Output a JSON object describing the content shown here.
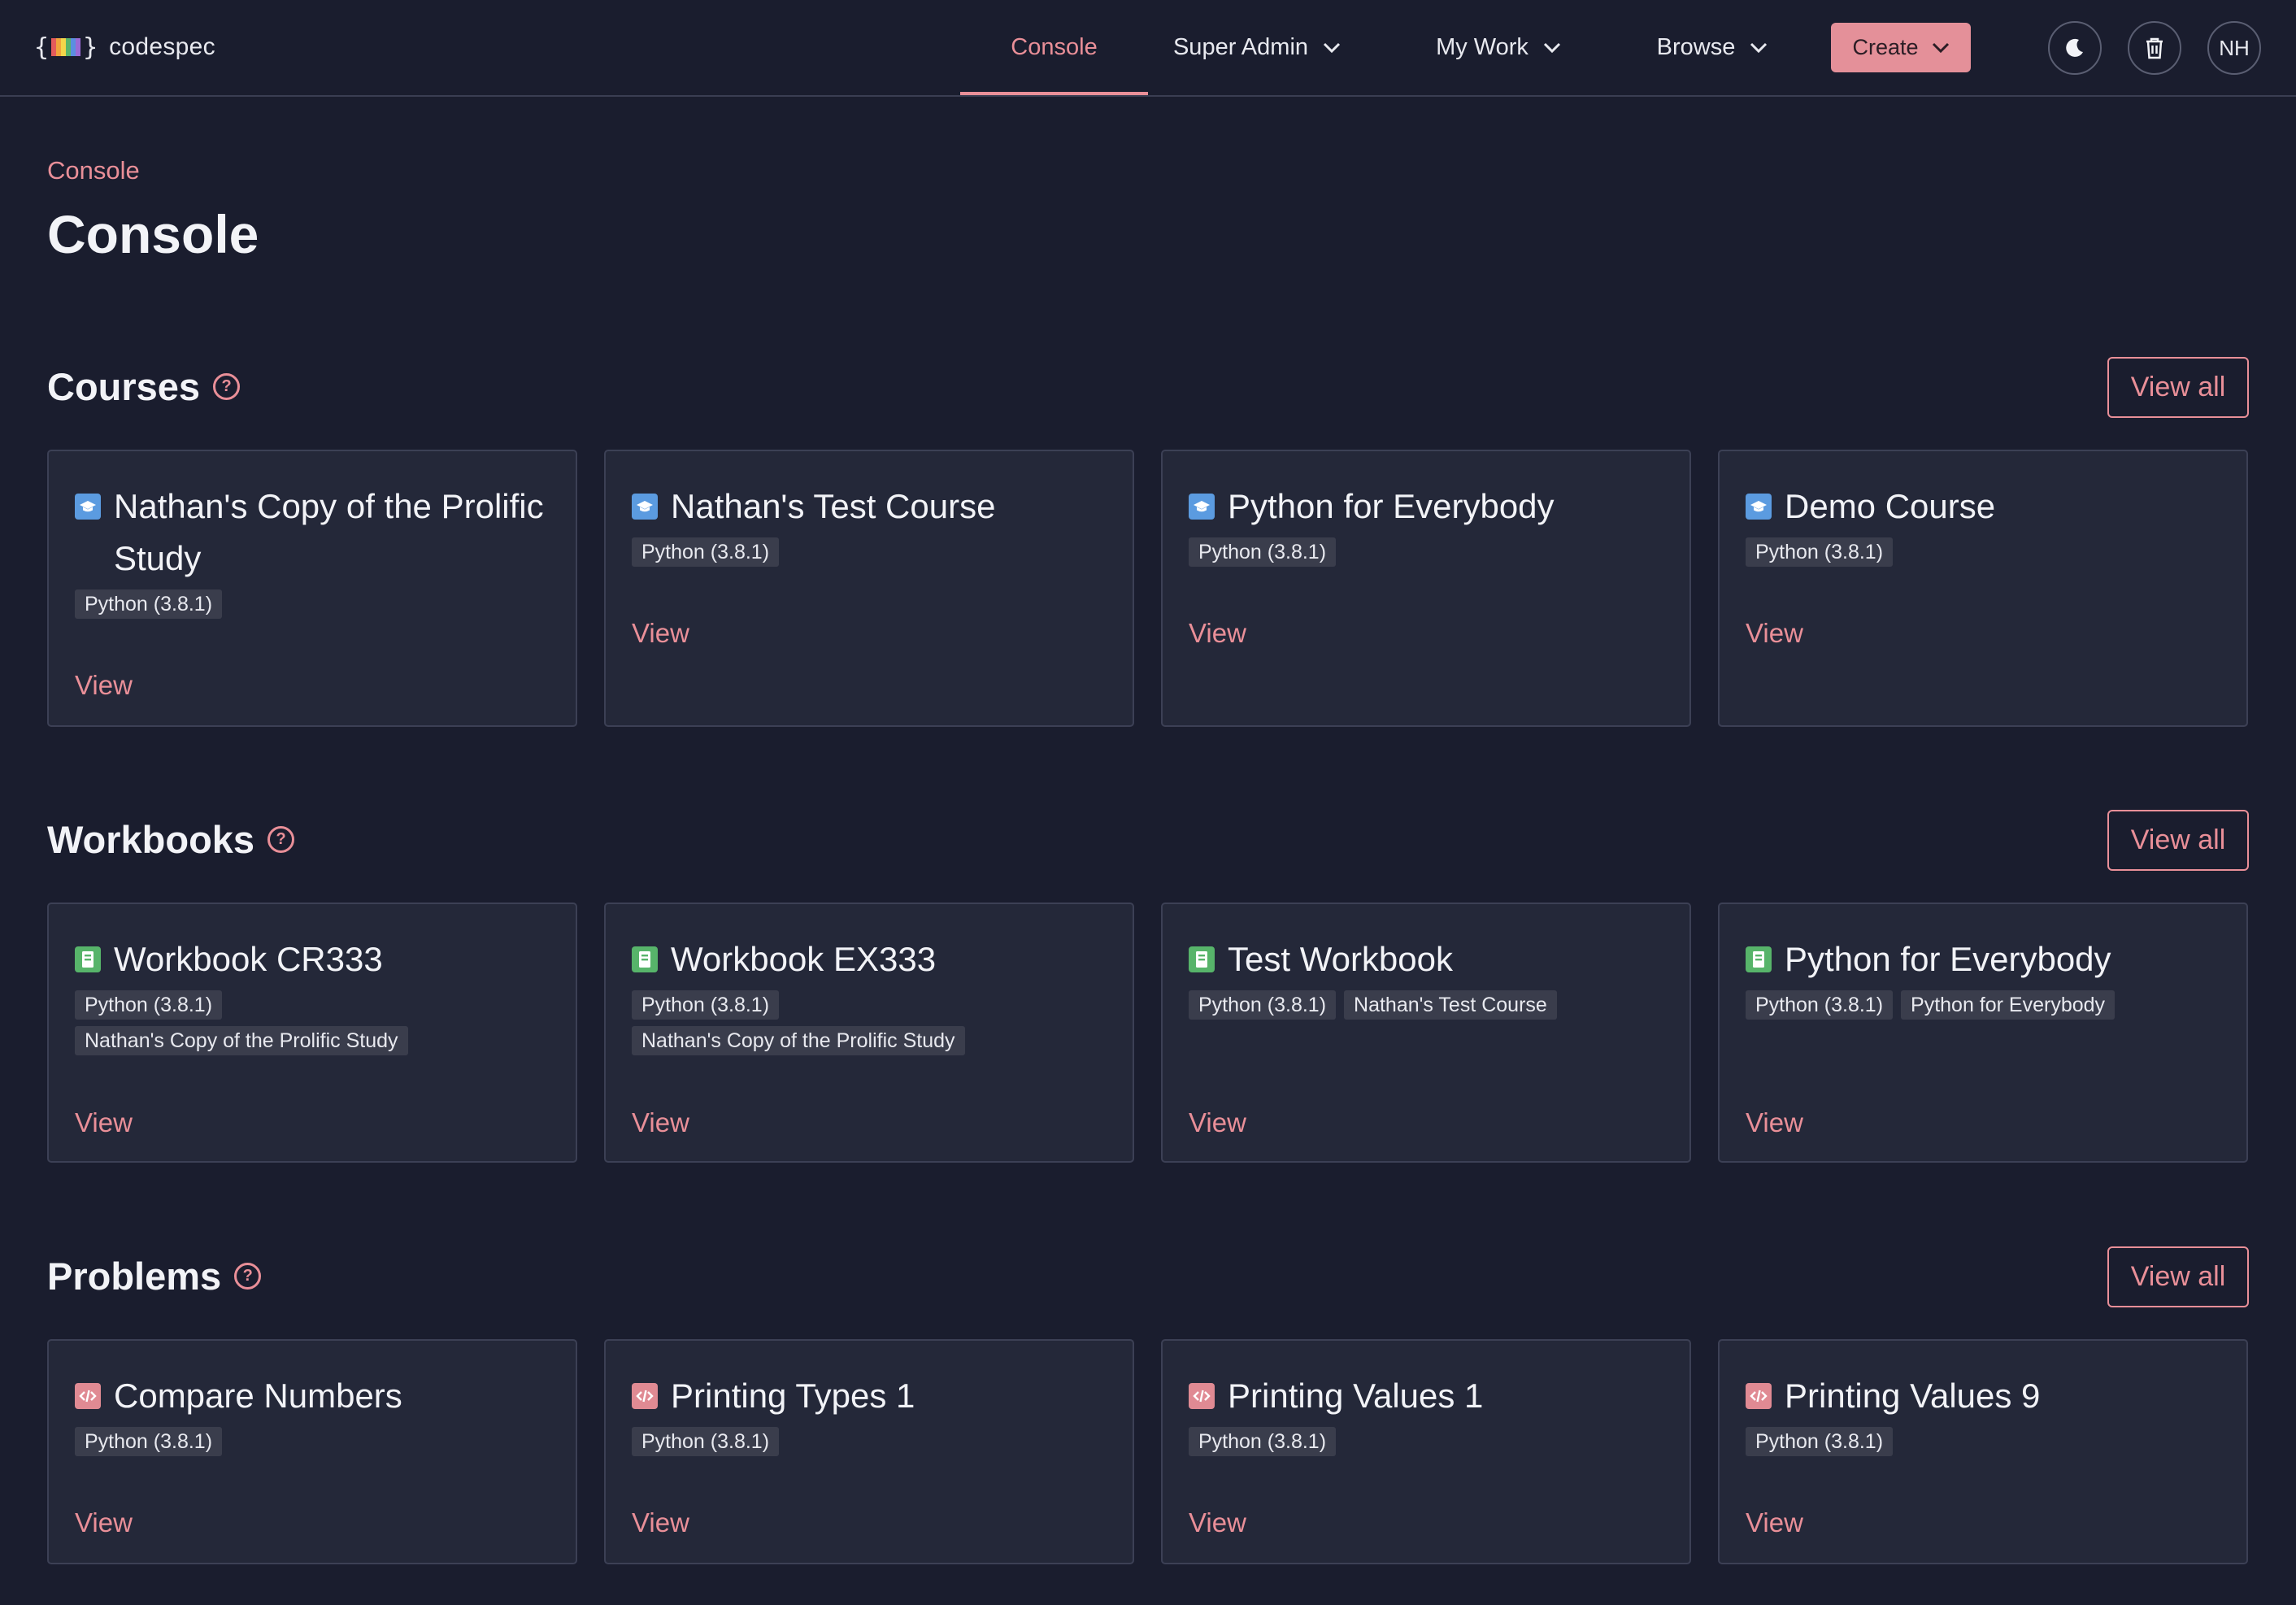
{
  "app": {
    "logo_left": "{",
    "logo_right": "}",
    "logo_colors": [
      "#e45b5b",
      "#f0a43c",
      "#f2d54a",
      "#58b46a",
      "#5b8fe0",
      "#9a6bd6"
    ],
    "name": "codespec"
  },
  "nav": {
    "console": "Console",
    "super_admin": "Super Admin",
    "my_work": "My Work",
    "browse": "Browse",
    "create": "Create",
    "avatar_initials": "NH"
  },
  "breadcrumb": "Console",
  "page_title": "Console",
  "view_all_label": "View all",
  "view_label": "View",
  "sections": {
    "courses": {
      "title": "Courses",
      "items": [
        {
          "title": "Nathan's Copy of the Prolific Study",
          "tags": [
            "Python (3.8.1)"
          ]
        },
        {
          "title": "Nathan's Test Course",
          "tags": [
            "Python (3.8.1)"
          ]
        },
        {
          "title": "Python for Everybody",
          "tags": [
            "Python (3.8.1)"
          ]
        },
        {
          "title": "Demo Course",
          "tags": [
            "Python (3.8.1)"
          ]
        }
      ]
    },
    "workbooks": {
      "title": "Workbooks",
      "items": [
        {
          "title": "Workbook CR333",
          "tags": [
            "Python (3.8.1)",
            "Nathan's Copy of the Prolific Study"
          ]
        },
        {
          "title": "Workbook EX333",
          "tags": [
            "Python (3.8.1)",
            "Nathan's Copy of the Prolific Study"
          ]
        },
        {
          "title": "Test Workbook",
          "tags": [
            "Python (3.8.1)",
            "Nathan's Test Course"
          ]
        },
        {
          "title": "Python for Everybody",
          "tags": [
            "Python (3.8.1)",
            "Python for Everybody"
          ]
        }
      ]
    },
    "problems": {
      "title": "Problems",
      "items": [
        {
          "title": "Compare Numbers",
          "tags": [
            "Python (3.8.1)"
          ]
        },
        {
          "title": "Printing Types 1",
          "tags": [
            "Python (3.8.1)"
          ]
        },
        {
          "title": "Printing Values 1",
          "tags": [
            "Python (3.8.1)"
          ]
        },
        {
          "title": "Printing Values 9",
          "tags": [
            "Python (3.8.1)"
          ]
        }
      ]
    }
  },
  "icons": {
    "course": "graduation-cap-icon",
    "workbook": "book-icon",
    "problem": "code-icon",
    "theme": "moon-icon",
    "trash": "trash-icon",
    "help": "help-circle-icon"
  },
  "colors": {
    "background": "#1a1d2e",
    "card": "#242839",
    "accent": "#e98f98",
    "course_icon": "#5b9be0",
    "workbook_icon": "#57b46a",
    "problem_icon": "#e08a93"
  }
}
